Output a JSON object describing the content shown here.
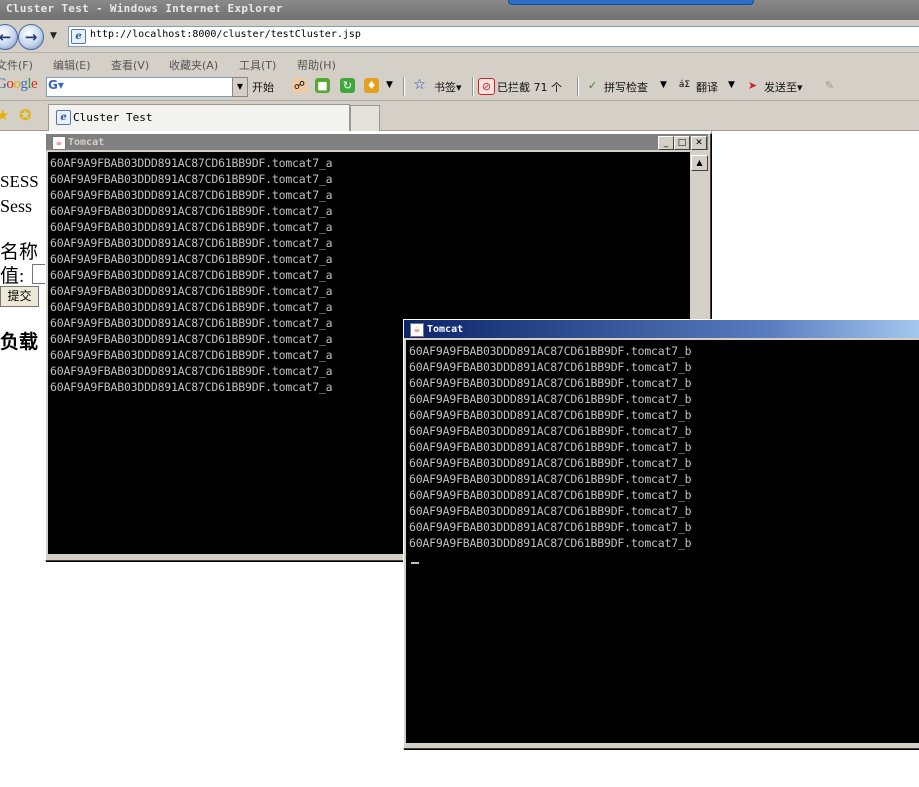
{
  "browser": {
    "title": "Cluster Test - Windows Internet Explorer",
    "address": "http://localhost:8000/cluster/testCluster.jsp",
    "menu": [
      "文件(F)",
      "编辑(E)",
      "查看(V)",
      "收藏夹(A)",
      "工具(T)",
      "帮助(H)"
    ],
    "toolbar": {
      "google_logo": "Google",
      "start_label": "开始",
      "bookmarks_label": "书签▾",
      "blocked_label": "已拦截 71 个",
      "spellcheck_label": "拼写检查",
      "translate_label": "翻译",
      "sendto_label": "发送至▾"
    },
    "tab_label": "Cluster Test"
  },
  "page": {
    "line1": "SESS",
    "line2": "Sess",
    "name_label": "名称",
    "value_label": "值:",
    "submit_label": "提交",
    "load_label": "负载"
  },
  "console_a": {
    "title": "Tomcat",
    "lines": [
      "60AF9A9FBAB03DDD891AC87CD61BB9DF.tomcat7_a",
      "60AF9A9FBAB03DDD891AC87CD61BB9DF.tomcat7_a",
      "60AF9A9FBAB03DDD891AC87CD61BB9DF.tomcat7_a",
      "60AF9A9FBAB03DDD891AC87CD61BB9DF.tomcat7_a",
      "60AF9A9FBAB03DDD891AC87CD61BB9DF.tomcat7_a",
      "60AF9A9FBAB03DDD891AC87CD61BB9DF.tomcat7_a",
      "60AF9A9FBAB03DDD891AC87CD61BB9DF.tomcat7_a",
      "60AF9A9FBAB03DDD891AC87CD61BB9DF.tomcat7_a",
      "60AF9A9FBAB03DDD891AC87CD61BB9DF.tomcat7_a",
      "60AF9A9FBAB03DDD891AC87CD61BB9DF.tomcat7_a",
      "60AF9A9FBAB03DDD891AC87CD61BB9DF.tomcat7_a",
      "60AF9A9FBAB03DDD891AC87CD61BB9DF.tomcat7_a",
      "60AF9A9FBAB03DDD891AC87CD61BB9DF.tomcat7_a",
      "60AF9A9FBAB03DDD891AC87CD61BB9DF.tomcat7_a",
      "60AF9A9FBAB03DDD891AC87CD61BB9DF.tomcat7_a"
    ]
  },
  "console_b": {
    "title": "Tomcat",
    "lines": [
      "60AF9A9FBAB03DDD891AC87CD61BB9DF.tomcat7_b",
      "60AF9A9FBAB03DDD891AC87CD61BB9DF.tomcat7_b",
      "60AF9A9FBAB03DDD891AC87CD61BB9DF.tomcat7_b",
      "60AF9A9FBAB03DDD891AC87CD61BB9DF.tomcat7_b",
      "60AF9A9FBAB03DDD891AC87CD61BB9DF.tomcat7_b",
      "60AF9A9FBAB03DDD891AC87CD61BB9DF.tomcat7_b",
      "60AF9A9FBAB03DDD891AC87CD61BB9DF.tomcat7_b",
      "60AF9A9FBAB03DDD891AC87CD61BB9DF.tomcat7_b",
      "60AF9A9FBAB03DDD891AC87CD61BB9DF.tomcat7_b",
      "60AF9A9FBAB03DDD891AC87CD61BB9DF.tomcat7_b",
      "60AF9A9FBAB03DDD891AC87CD61BB9DF.tomcat7_b",
      "60AF9A9FBAB03DDD891AC87CD61BB9DF.tomcat7_b",
      "60AF9A9FBAB03DDD891AC87CD61BB9DF.tomcat7_b"
    ]
  },
  "colors": {
    "console_bg": "#000000",
    "console_text": "#c0c0c0",
    "active_title": "#0a246a",
    "inactive_title": "#808080"
  }
}
